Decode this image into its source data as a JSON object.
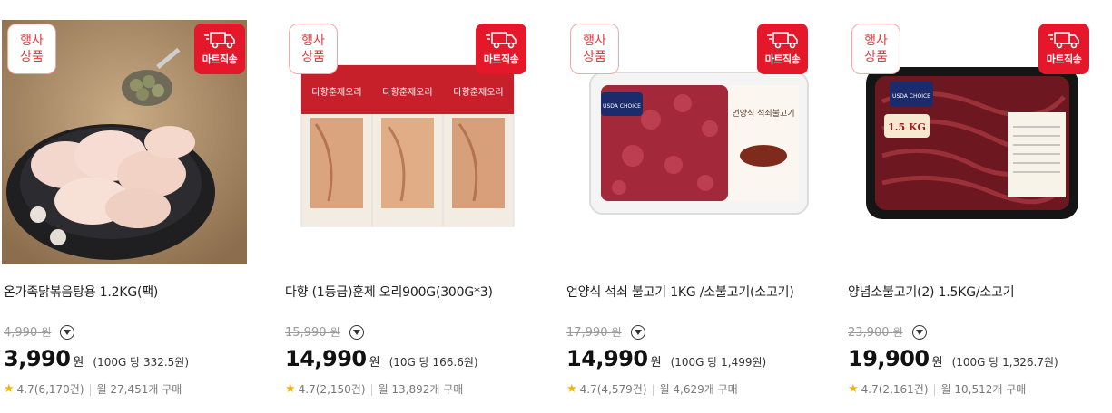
{
  "badges": {
    "event_label": "행사상품",
    "event_line1": "행사",
    "event_line2": "상품",
    "mart_label": "마트직송"
  },
  "colors": {
    "mart_red": "#e4172b",
    "event_red": "#e23b3b",
    "star": "#f5b400"
  },
  "products": [
    {
      "title": "온가족닭볶음탕용 1.2KG(팩)",
      "original_price": "4,990",
      "original_unit": "원",
      "price": "3,990",
      "currency": "원",
      "unit_price": "(100G 당 332.5원)",
      "rating": "4.7",
      "reviews": "(6,170건)",
      "monthly": "월 27,451개 구매"
    },
    {
      "title": "다향 (1등급)훈제 오리900G(300G*3)",
      "original_price": "15,990",
      "original_unit": "원",
      "price": "14,990",
      "currency": "원",
      "unit_price": "(10G 당 166.6원)",
      "rating": "4.7",
      "reviews": "(2,150건)",
      "monthly": "월 13,892개 구매",
      "pack_text": "다향훈제오리"
    },
    {
      "title": "언양식 석쇠 불고기 1KG /소불고기(소고기)",
      "original_price": "17,990",
      "original_unit": "원",
      "price": "14,990",
      "currency": "원",
      "unit_price": "(100G 당 1,499원)",
      "rating": "4.7",
      "reviews": "(4,579건)",
      "monthly": "월 4,629개 구매",
      "pack_text": "언양식 석쇠불고기",
      "usda": "USDA CHOICE"
    },
    {
      "title": "양념소불고기(2) 1.5KG/소고기",
      "original_price": "23,900",
      "original_unit": "원",
      "price": "19,900",
      "currency": "원",
      "unit_price": "(100G 당 1,326.7원)",
      "rating": "4.7",
      "reviews": "(2,161건)",
      "monthly": "월 10,512개 구매",
      "weight_tag": "1.5 KG",
      "usda": "USDA CHOICE"
    }
  ]
}
